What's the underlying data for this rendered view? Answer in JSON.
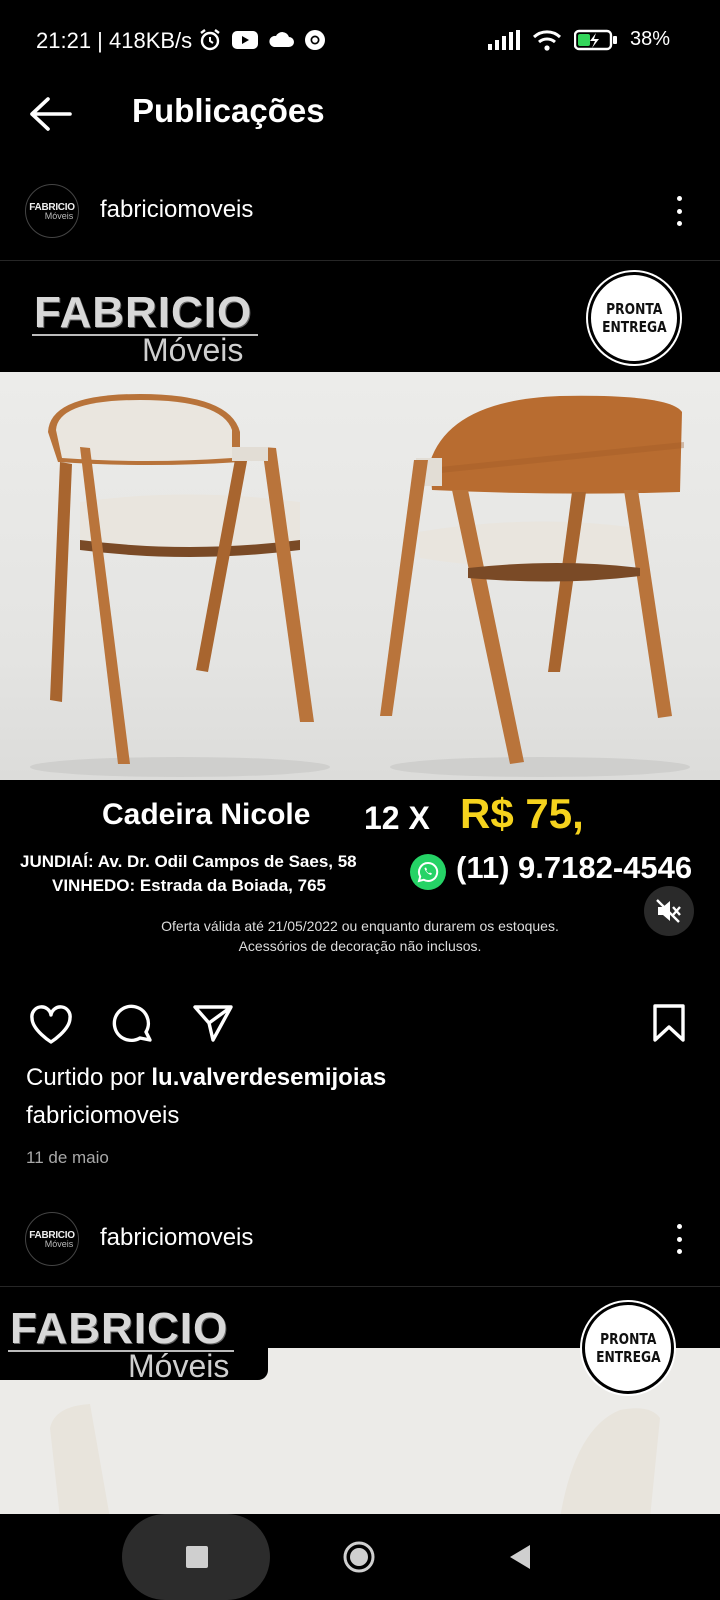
{
  "status_bar": {
    "time_speed": "21:21 | 418KB/s",
    "battery": "38%"
  },
  "header": {
    "title": "Publicações"
  },
  "post1": {
    "username": "fabriciomoveis",
    "avatar_text_1": "FABRICIO",
    "avatar_text_2": "Móveis",
    "logo_line1": "FABRICIO",
    "logo_line2": "Móveis",
    "badge_line1": "PRONTA",
    "badge_line2": "ENTREGA",
    "product_name": "Cadeira Nicole",
    "price_prefix": "12 X",
    "price": "R$ 75,",
    "address_1": "JUNDIAÍ: Av. Dr. Odil Campos de Saes, 58",
    "address_2": "VINHEDO: Estrada da Boiada, 765",
    "phone": "(11) 9.7182-4546",
    "fine_print_1": "Oferta válida até 21/05/2022 ou enquanto durarem os estoques.",
    "fine_print_2": "Acessórios de decoração não inclusos.",
    "liked_by_prefix": "Curtido por ",
    "liked_by_user": "lu.valverdesemijoias",
    "caption_user": "fabriciomoveis",
    "date": "11 de maio"
  },
  "post2": {
    "username": "fabriciomoveis",
    "avatar_text_1": "FABRICIO",
    "avatar_text_2": "Móveis",
    "logo_line1": "FABRICIO",
    "logo_line2": "Móveis",
    "badge_line1": "PRONTA",
    "badge_line2": "ENTREGA"
  },
  "icons": {
    "back": "arrow-left-icon",
    "more": "more-vertical-icon",
    "like": "heart-icon",
    "comment": "comment-icon",
    "share": "send-icon",
    "save": "bookmark-icon",
    "mute": "volume-mute-icon",
    "whatsapp": "whatsapp-icon"
  },
  "colors": {
    "background": "#000000",
    "price_yellow": "#f5d21d",
    "whatsapp_green": "#25d366",
    "secondary_text": "#a8a8a8"
  }
}
